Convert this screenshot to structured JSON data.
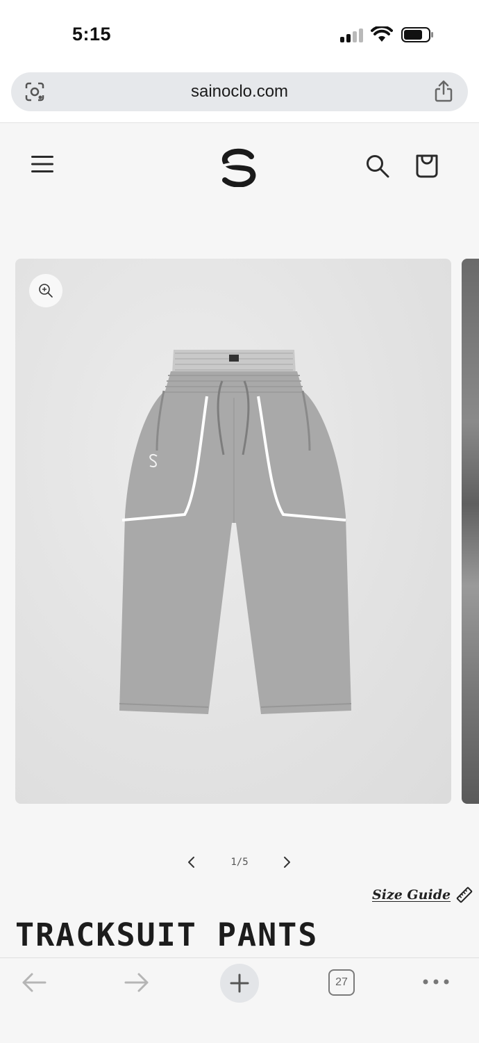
{
  "status_bar": {
    "time": "5:15"
  },
  "browser": {
    "url": "sainoclo.com",
    "open_tabs_count": "27"
  },
  "header": {
    "icons": [
      "menu-icon",
      "logo",
      "search-icon",
      "bag-icon"
    ]
  },
  "gallery": {
    "current_slide": 1,
    "total_slides": 5,
    "counter_text": "1/5"
  },
  "size_guide": {
    "label": "Size Guide"
  },
  "product": {
    "title": "TRACKSUIT PANTS"
  },
  "colors": {
    "background": "#f6f6f6",
    "text": "#1a1a1a",
    "url_pill": "#e6e8eb",
    "pants_gray": "#a9a9a9"
  }
}
